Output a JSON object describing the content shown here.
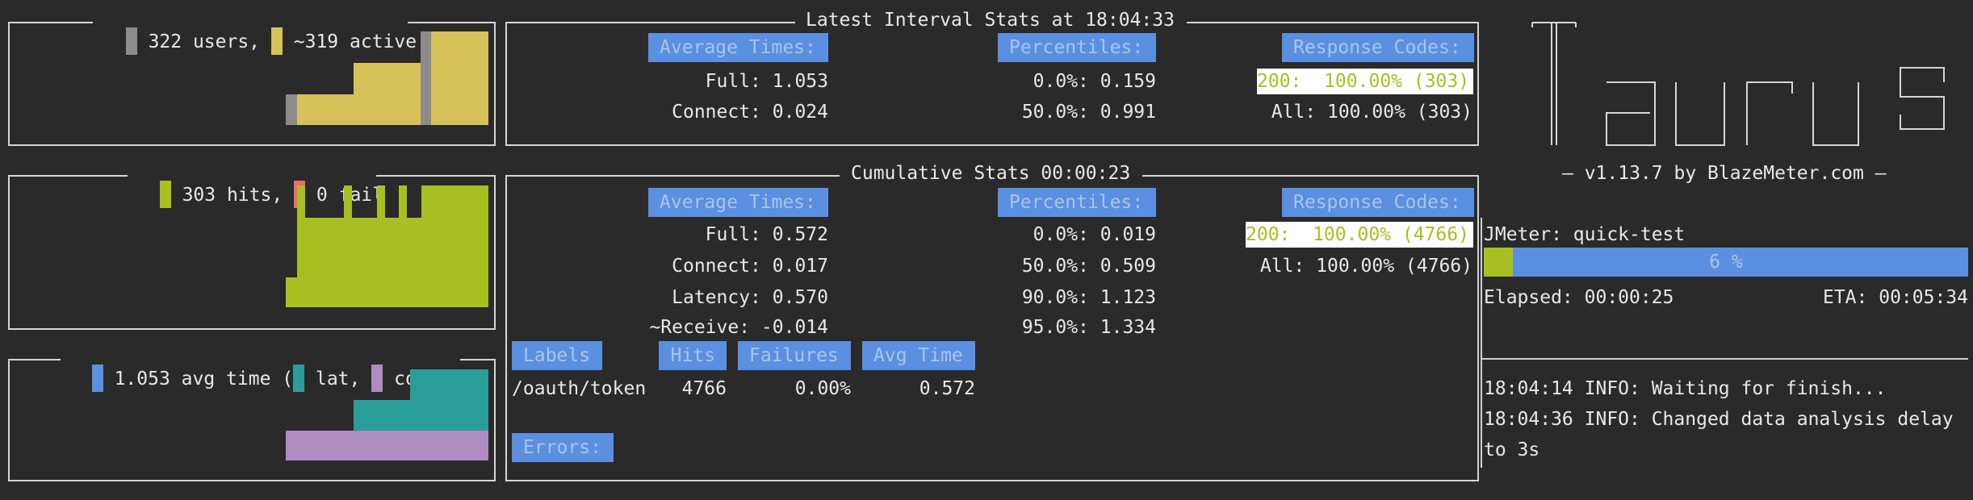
{
  "colors": {
    "gray": "#8c8c8c",
    "users_yellow": "#d7c25a",
    "hits_green": "#a8bf22",
    "fail_red": "#f06b6b",
    "avg_blue": "#5b8fe0",
    "lat_teal": "#2a9d9a",
    "conn_purple": "#b08cc2",
    "header_blue": "#5b8fe0"
  },
  "users_panel": {
    "users_text": "322 users,",
    "active_text": "~319 active",
    "levels": {
      "users": 322,
      "active": 319
    }
  },
  "hits_panel": {
    "hits_text": "303 hits,",
    "fail_text": "0 fail",
    "levels": {
      "hits": 303,
      "fail": 0
    }
  },
  "times_panel": {
    "avg_text": "1.053 avg time (",
    "lat_text": "lat,",
    "conn_text": "conn)",
    "levels": {
      "avg_time": 1.053,
      "latency": 0.57,
      "connect": 0.024
    }
  },
  "interval": {
    "title": "Latest Interval Stats at 18:04:33",
    "avg_header": "Average Times:",
    "pct_header": "Percentiles:",
    "codes_header": "Response Codes:",
    "avg_rows": [
      "Full: 1.053",
      "Connect: 0.024"
    ],
    "pct_rows": [
      "0.0%: 0.159",
      "50.0%: 0.991"
    ],
    "code_200": "200:  100.00% (303)",
    "code_all": "All: 100.00% (303)"
  },
  "cumulative": {
    "title": "Cumulative Stats 00:00:23",
    "avg_header": "Average Times:",
    "pct_header": "Percentiles:",
    "codes_header": "Response Codes:",
    "avg_rows": [
      "Full: 0.572",
      "Connect: 0.017",
      "Latency: 0.570",
      "~Receive: -0.014"
    ],
    "pct_rows": [
      "0.0%: 0.019",
      "50.0%: 0.509",
      "90.0%: 1.123",
      "95.0%: 1.334"
    ],
    "code_200": "200:  100.00% (4766)",
    "code_all": "All: 100.00% (4766)",
    "table_headers": [
      "Labels",
      "Hits",
      "Failures",
      "Avg Time"
    ],
    "table_row": [
      "/oauth/token",
      "4766",
      "0.00%",
      "0.572"
    ],
    "errors_header": "Errors:"
  },
  "sidebar": {
    "version": "– v1.13.7 by BlazeMeter.com –",
    "executor": "JMeter: quick-test",
    "progress_text": "6 %",
    "progress_fraction": 0.06,
    "elapsed": "Elapsed: 00:00:25",
    "eta": "ETA: 00:05:34",
    "log": [
      "18:04:14 INFO: Waiting for finish...",
      "18:04:36 INFO: Changed data analysis delay",
      "to 3s"
    ]
  }
}
